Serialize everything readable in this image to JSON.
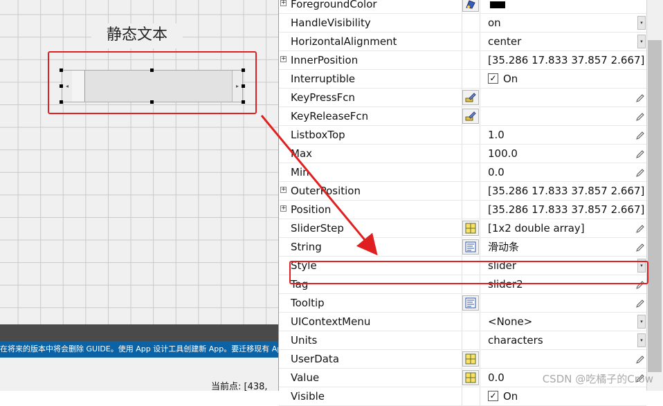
{
  "canvas": {
    "static_text": "静态文本"
  },
  "status": {
    "banner": "在将来的版本中将会删除 GUIDE。使用 App 设计工具创建新 App。要迁移现有 Ap",
    "current_point": "当前点:  [438,"
  },
  "inspector": {
    "properties": [
      {
        "name": "ForegroundColor",
        "expandable": true,
        "editor": "color-palette-icon",
        "value": "",
        "swatch": "#000000"
      },
      {
        "name": "HandleVisibility",
        "expandable": false,
        "value": "on",
        "control": "dropdown"
      },
      {
        "name": "HorizontalAlignment",
        "expandable": false,
        "value": "center",
        "control": "dropdown"
      },
      {
        "name": "InnerPosition",
        "expandable": true,
        "value": "[35.286 17.833 37.857 2.667]"
      },
      {
        "name": "Interruptible",
        "expandable": false,
        "value": "On",
        "control": "checkbox"
      },
      {
        "name": "KeyPressFcn",
        "expandable": false,
        "editor": "callback-icon",
        "value": "",
        "control": "pencil"
      },
      {
        "name": "KeyReleaseFcn",
        "expandable": false,
        "editor": "callback-icon",
        "value": "",
        "control": "pencil"
      },
      {
        "name": "ListboxTop",
        "expandable": false,
        "value": "1.0",
        "control": "pencil"
      },
      {
        "name": "Max",
        "expandable": false,
        "value": "100.0",
        "control": "pencil"
      },
      {
        "name": "Min",
        "expandable": false,
        "value": "0.0",
        "control": "pencil"
      },
      {
        "name": "OuterPosition",
        "expandable": true,
        "value": "[35.286 17.833 37.857 2.667]"
      },
      {
        "name": "Position",
        "expandable": true,
        "value": "[35.286 17.833 37.857 2.667]"
      },
      {
        "name": "SliderStep",
        "expandable": false,
        "editor": "array-grid-icon",
        "value": "[1x2  double array]",
        "control": "pencil"
      },
      {
        "name": "String",
        "expandable": false,
        "editor": "text-editor-icon",
        "value": "滑动条",
        "control": "pencil"
      },
      {
        "name": "Style",
        "expandable": false,
        "value": "slider",
        "control": "dropdown"
      },
      {
        "name": "Tag",
        "expandable": false,
        "value": "slider2",
        "control": "pencil"
      },
      {
        "name": "Tooltip",
        "expandable": false,
        "editor": "text-editor-icon",
        "value": "",
        "control": "pencil"
      },
      {
        "name": "UIContextMenu",
        "expandable": false,
        "value": "<None>",
        "control": "dropdown"
      },
      {
        "name": "Units",
        "expandable": false,
        "value": "characters",
        "control": "dropdown"
      },
      {
        "name": "UserData",
        "expandable": false,
        "editor": "array-grid-icon",
        "value": "",
        "control": "pencil"
      },
      {
        "name": "Value",
        "expandable": false,
        "editor": "array-grid-icon",
        "value": "0.0",
        "control": "pencil"
      },
      {
        "name": "Visible",
        "expandable": false,
        "value": "On",
        "control": "checkbox"
      }
    ]
  },
  "watermark": "CSDN @吃橘子的Crow",
  "colors": {
    "highlight": "#e02020",
    "banner": "#0b63a5"
  }
}
